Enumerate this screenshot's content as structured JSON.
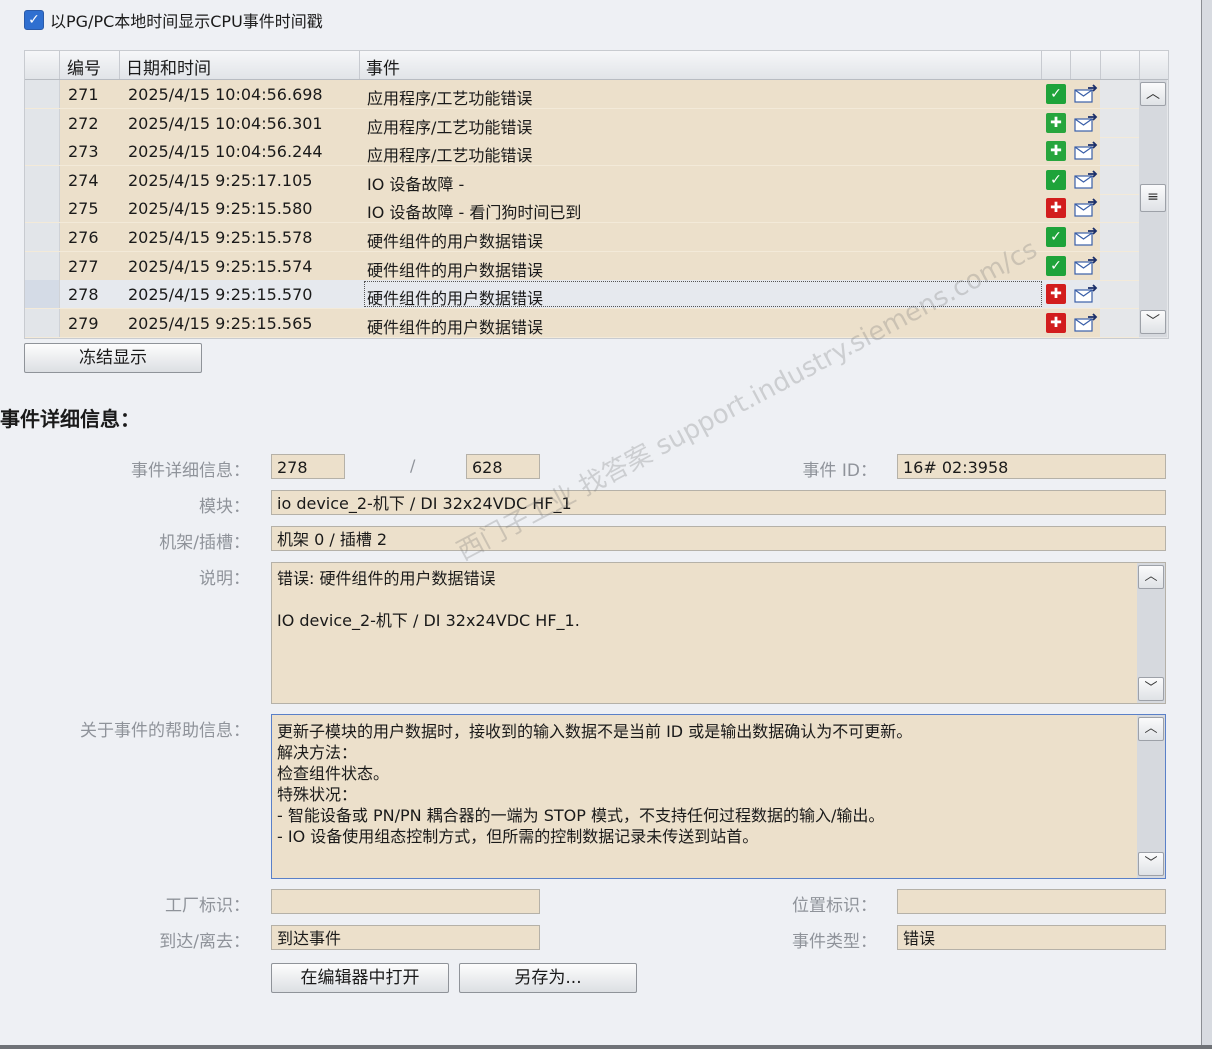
{
  "checkbox": {
    "label": "以PG/PC本地时间显示CPU事件时间戳",
    "checked": true
  },
  "table": {
    "headers": {
      "num": "编号",
      "datetime": "日期和时间",
      "event": "事件"
    },
    "rows": [
      {
        "num": "271",
        "datetime": "2025/4/15 10:04:56.698",
        "event": "应用程序/工艺功能错误",
        "status": "ok"
      },
      {
        "num": "272",
        "datetime": "2025/4/15 10:04:56.301",
        "event": "应用程序/工艺功能错误",
        "status": "maintenance"
      },
      {
        "num": "273",
        "datetime": "2025/4/15 10:04:56.244",
        "event": "应用程序/工艺功能错误",
        "status": "maintenance"
      },
      {
        "num": "274",
        "datetime": "2025/4/15 9:25:17.105",
        "event": "IO 设备故障 -",
        "status": "ok"
      },
      {
        "num": "275",
        "datetime": "2025/4/15 9:25:15.580",
        "event": "IO 设备故障 - 看门狗时间已到",
        "status": "error"
      },
      {
        "num": "276",
        "datetime": "2025/4/15 9:25:15.578",
        "event": "硬件组件的用户数据错误",
        "status": "ok"
      },
      {
        "num": "277",
        "datetime": "2025/4/15 9:25:15.574",
        "event": "硬件组件的用户数据错误",
        "status": "ok"
      },
      {
        "num": "278",
        "datetime": "2025/4/15 9:25:15.570",
        "event": "硬件组件的用户数据错误",
        "status": "error"
      },
      {
        "num": "279",
        "datetime": "2025/4/15 9:25:15.565",
        "event": "硬件组件的用户数据错误",
        "status": "error"
      }
    ],
    "selected_row": "278"
  },
  "freeze_button": "冻结显示",
  "details": {
    "title": "事件详细信息：",
    "labels": {
      "detail": "事件详细信息：",
      "module": "模块：",
      "rack_slot": "机架/插槽：",
      "description": "说明：",
      "help": "关于事件的帮助信息：",
      "plant_id": "工厂标识：",
      "location_id": "位置标识：",
      "arrive_leave": "到达/离去：",
      "event_type": "事件类型：",
      "event_id": "事件 ID："
    },
    "event_index": "278",
    "separator": "/",
    "event_total": "628",
    "event_id": "16# 02:3958",
    "module": "io device_2-机下 / DI 32x24VDC HF_1",
    "rack_slot": "机架 0 / 插槽 2",
    "description_lines": [
      "错误: 硬件组件的用户数据错误",
      "",
      "IO device_2-机下 / DI 32x24VDC HF_1."
    ],
    "help_lines": [
      "更新子模块的用户数据时，接收到的输入数据不是当前 ID 或是输出数据确认为不可更新。",
      "解决方法：",
      "检查组件状态。",
      "特殊状况：",
      "- 智能设备或 PN/PN 耦合器的一端为 STOP 模式，不支持任何过程数据的输入/输出。",
      "- IO 设备使用组态控制方式，但所需的控制数据记录未传送到站首。"
    ],
    "plant_id": "",
    "location_id": "",
    "arrive_leave": "到达事件",
    "event_type": "错误"
  },
  "buttons": {
    "open_in_editor": "在编辑器中打开",
    "save_as": "另存为..."
  },
  "watermark": "西门子工业 找答案 support.industry.siemens.com/cs",
  "colors": {
    "field_bg": "#ece0cb",
    "ok": "#1ea33a",
    "error": "#d21d1d",
    "focus_border": "#5a80c8"
  }
}
